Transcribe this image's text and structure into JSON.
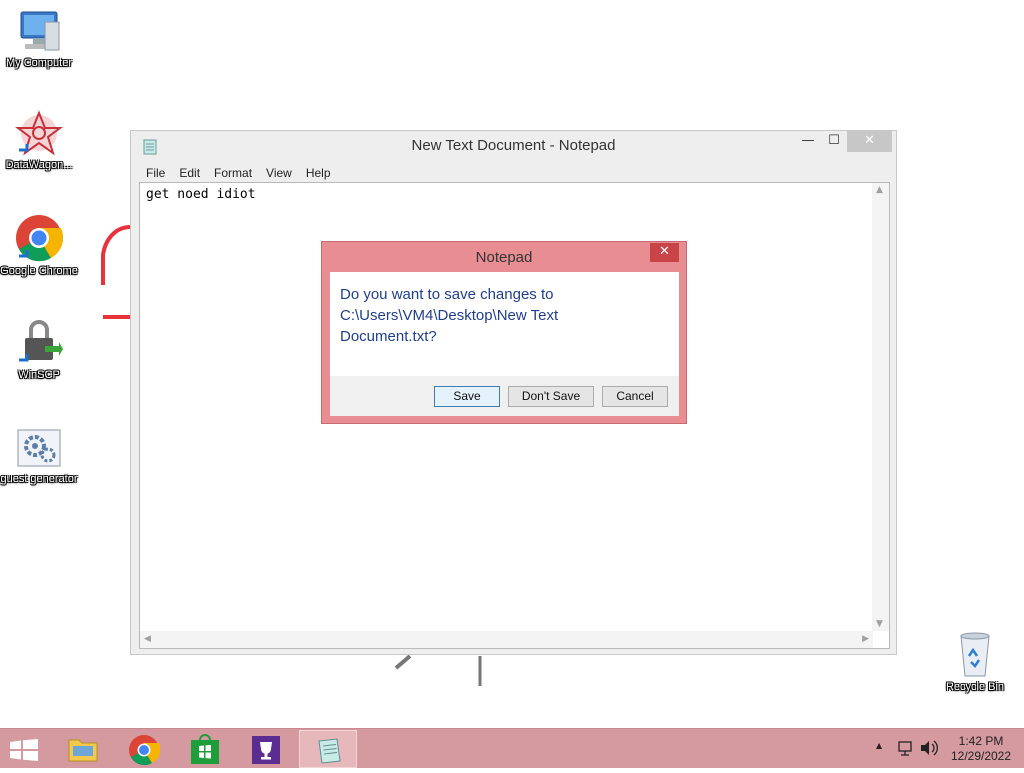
{
  "desktop": {
    "icons": [
      {
        "label": "My Computer"
      },
      {
        "label": "DataWagon..."
      },
      {
        "label": "Google Chrome"
      },
      {
        "label": "WinSCP"
      },
      {
        "label": "guest generator"
      },
      {
        "label": "Recycle Bin"
      }
    ]
  },
  "notepad": {
    "title": "New Text Document - Notepad",
    "menu": [
      "File",
      "Edit",
      "Format",
      "View",
      "Help"
    ],
    "content": "get noed idiot",
    "buttons": {
      "minimize": "—",
      "maximize": "☐",
      "close": "✕"
    }
  },
  "dialog": {
    "title": "Notepad",
    "message": "Do you want to save changes to C:\\Users\\VM4\\Desktop\\New Text Document.txt?",
    "buttons": {
      "save": "Save",
      "dont_save": "Don't Save",
      "cancel": "Cancel"
    },
    "close": "✕"
  },
  "taskbar": {
    "pinned": [
      "start-button",
      "file-explorer",
      "google-chrome",
      "store",
      "trophy-app",
      "notepad"
    ],
    "clock": {
      "time": "1:42 PM",
      "date": "12/29/2022"
    }
  }
}
